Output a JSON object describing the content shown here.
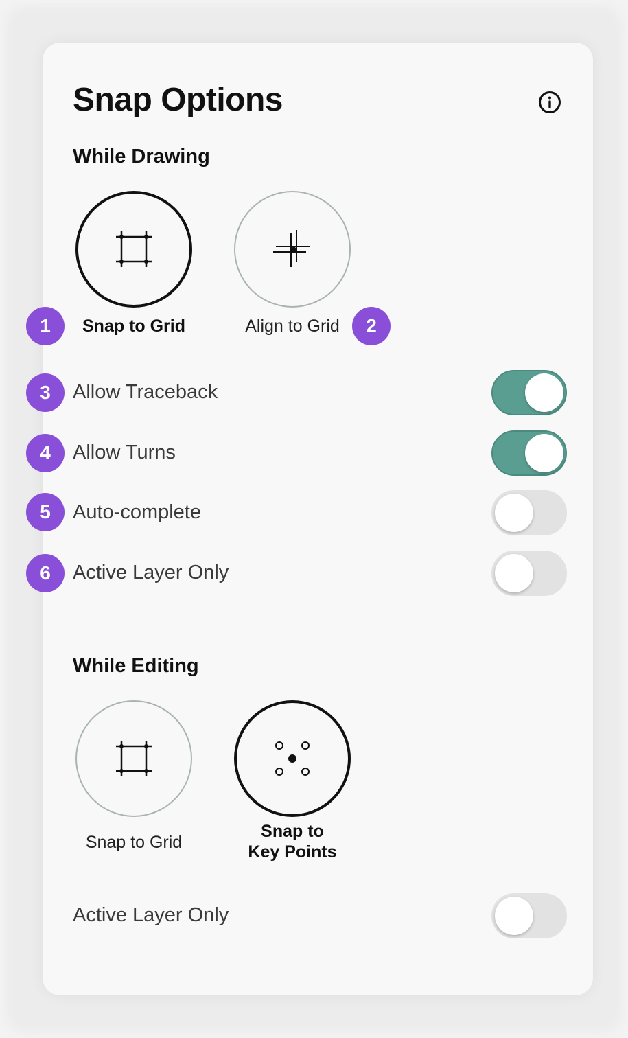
{
  "panel": {
    "title": "Snap Options"
  },
  "icons": {
    "info": "info-icon",
    "grid": "grid-square-icon",
    "align": "align-crosshair-icon",
    "keypoints": "key-points-icon"
  },
  "colors": {
    "accent_badge": "#8a4fd8",
    "toggle_on": "#5a9e92",
    "toggle_off": "#e2e2e2"
  },
  "drawing": {
    "title": "While Drawing",
    "options": [
      {
        "label": "Snap to Grid",
        "selected": true,
        "badge": "1"
      },
      {
        "label": "Align to Grid",
        "selected": false,
        "badge": "2"
      }
    ],
    "toggles": [
      {
        "badge": "3",
        "label": "Allow Traceback",
        "on": true
      },
      {
        "badge": "4",
        "label": "Allow Turns",
        "on": true
      },
      {
        "badge": "5",
        "label": "Auto-complete",
        "on": false
      },
      {
        "badge": "6",
        "label": "Active Layer Only",
        "on": false
      }
    ]
  },
  "editing": {
    "title": "While Editing",
    "options": [
      {
        "label": "Snap to Grid",
        "selected": false
      },
      {
        "label_line1": "Snap to",
        "label_line2": "Key Points",
        "selected": true
      }
    ],
    "toggles": [
      {
        "label": "Active Layer Only",
        "on": false
      }
    ]
  }
}
